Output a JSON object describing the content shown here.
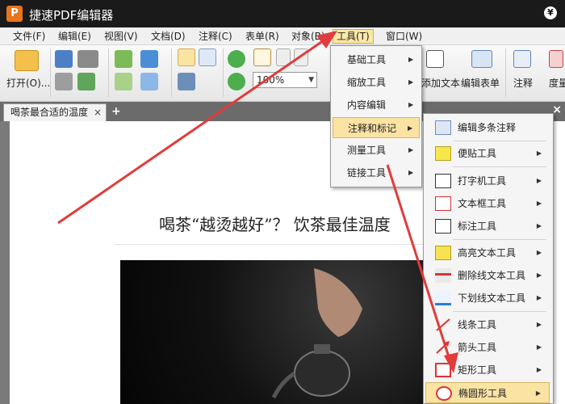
{
  "app": {
    "title": "捷速PDF编辑器",
    "logo_letter": "P",
    "title_right_icon": "¥"
  },
  "menu": [
    {
      "label": "文件(F)"
    },
    {
      "label": "编辑(E)"
    },
    {
      "label": "视图(V)"
    },
    {
      "label": "文档(D)"
    },
    {
      "label": "注释(C)"
    },
    {
      "label": "表单(R)"
    },
    {
      "label": "对象(B)"
    },
    {
      "label": "工具(T)",
      "active": true
    },
    {
      "label": "窗口(W)"
    }
  ],
  "toolbar": {
    "open_label": "打开(O)...",
    "zoom_value": "100%",
    "add_text_label": "添加文本",
    "edit_form_label": "编辑表单",
    "annotate_label": "注释",
    "measure_label": "度量",
    "icons": [
      "folder-open-icon",
      "save-icon",
      "print-icon",
      "scanner-icon",
      "email-icon",
      "import-icon",
      "export-icon",
      "undo-icon",
      "redo-icon",
      "hand-tool-icon",
      "select-text-icon",
      "snapshot-icon",
      "rotate-cw-icon",
      "rotate-ccw-icon",
      "actual-size-icon",
      "fit-page-icon",
      "fit-width-icon",
      "add-text-icon",
      "edit-form-icon",
      "annotate-icon",
      "measure-icon"
    ]
  },
  "tabs": {
    "doc_tab": "喝茶最合适的温度",
    "close": "×",
    "add": "+",
    "panel_close": "×"
  },
  "document": {
    "heading": "喝茶“越烫越好”？ 饮茶最佳温度"
  },
  "tools_menu": {
    "items": [
      {
        "label": "基础工具",
        "has_submenu": true
      },
      {
        "label": "缩放工具",
        "has_submenu": true
      },
      {
        "label": "内容编辑",
        "has_submenu": true
      },
      {
        "label": "注释和标记",
        "has_submenu": true,
        "highlighted": true
      },
      {
        "label": "测量工具",
        "has_submenu": true
      },
      {
        "label": "链接工具",
        "has_submenu": true
      }
    ]
  },
  "annotate_submenu": {
    "items": [
      {
        "label": "编辑多条注释",
        "icon": "edit-annotations-icon",
        "has_submenu": false
      },
      {
        "label": "便贴工具",
        "icon": "sticky-note-icon",
        "has_submenu": true
      },
      {
        "label": "打字机工具",
        "icon": "typewriter-icon",
        "has_submenu": true
      },
      {
        "label": "文本框工具",
        "icon": "text-box-icon",
        "has_submenu": true
      },
      {
        "label": "标注工具",
        "icon": "callout-icon",
        "has_submenu": true
      },
      {
        "label": "高亮文本工具",
        "icon": "highlight-text-icon",
        "has_submenu": true
      },
      {
        "label": "删除线文本工具",
        "icon": "strikethrough-text-icon",
        "has_submenu": true
      },
      {
        "label": "下划线文本工具",
        "icon": "underline-text-icon",
        "has_submenu": true
      },
      {
        "label": "线条工具",
        "icon": "line-tool-icon",
        "has_submenu": true
      },
      {
        "label": "箭头工具",
        "icon": "arrow-tool-icon",
        "has_submenu": true
      },
      {
        "label": "矩形工具",
        "icon": "rectangle-tool-icon",
        "has_submenu": true
      },
      {
        "label": "椭圆形工具",
        "icon": "ellipse-tool-icon",
        "has_submenu": true,
        "highlighted": true
      }
    ]
  },
  "colors": {
    "annotation_arrow": "#e23b3b",
    "highlight": "#fbe3a4",
    "titlebar": "#1a1a1a"
  }
}
